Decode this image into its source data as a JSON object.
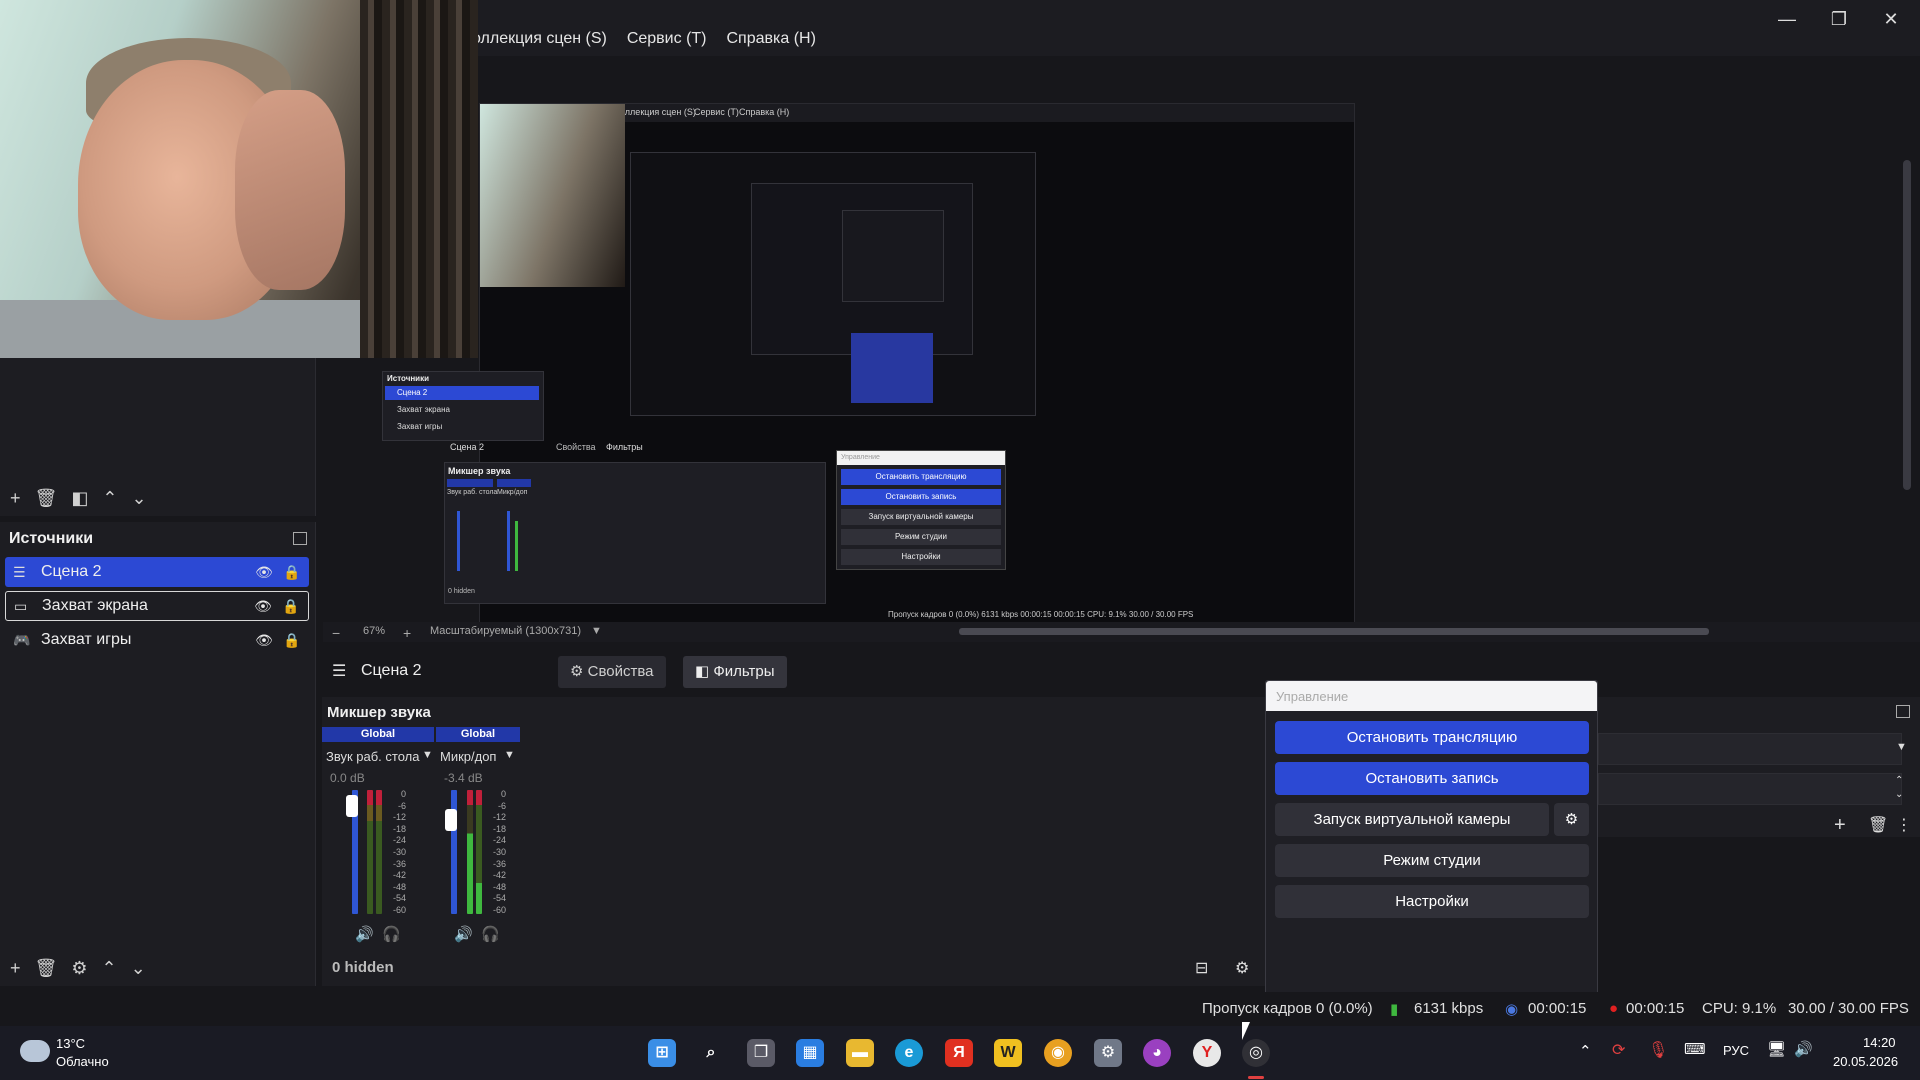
{
  "window": {
    "menu": [
      "оллекция сцен (S)",
      "Сервис (T)",
      "Справка (H)"
    ],
    "minimize_icon": "—",
    "maximize_icon": "❐",
    "close_icon": "✕"
  },
  "preview": {
    "zoom": "67%",
    "scale_mode": "Масштабируемый (1300x731)",
    "nested": {
      "menu": [
        "оллекция сцен (S)",
        "Сервис (T)",
        "Справка (H)"
      ],
      "sources_title": "Источники",
      "sources": [
        "Сцена 2",
        "Захват экрана",
        "Захват игры"
      ],
      "scene_label": "Сцена 2",
      "properties": "Свойства",
      "filters": "Фильтры",
      "mixer_title": "Микшер звука",
      "ch1": "Global",
      "ch2": "Global",
      "ch1_name": "Звук раб. стола",
      "ch2_name": "Микр/доп",
      "ch1_db": "0.0 dB",
      "ch2_db": "-3.4 dB",
      "hidden": "0 hidden",
      "controls_title": "Управление",
      "controls": [
        "Остановить трансляцию",
        "Остановить запись",
        "Запуск виртуальной камеры",
        "Режим студии",
        "Настройки"
      ],
      "status": "Пропуск кадров 0 (0.0%)   6131 kbps   00:00:15   00:00:15   CPU: 9.1%   30.00 / 30.00 FPS"
    }
  },
  "sources": {
    "title": "Источники",
    "items": [
      {
        "label": "Сцена 2",
        "icon": "list-icon"
      },
      {
        "label": "Захват экрана",
        "icon": "monitor-icon"
      },
      {
        "label": "Захват игры",
        "icon": "gamepad-icon"
      }
    ]
  },
  "context_bar": {
    "scene_label": "Сцена 2",
    "properties_label": "Свойства",
    "filters_label": "Фильтры"
  },
  "mixer": {
    "title": "Микшер звука",
    "channels": [
      {
        "header": "Global",
        "name": "Звук раб. стола",
        "db": "0.0 dB"
      },
      {
        "header": "Global",
        "name": "Микр/доп",
        "db": "-3.4 dB"
      }
    ],
    "scale": [
      "0",
      "-6",
      "-12",
      "-18",
      "-24",
      "-30",
      "-36",
      "-42",
      "-48",
      "-54",
      "-60"
    ],
    "hidden_label": "0 hidden"
  },
  "controls": {
    "title": "Управление",
    "stop_stream": "Остановить трансляцию",
    "stop_record": "Остановить запись",
    "virtual_cam": "Запуск виртуальной камеры",
    "studio_mode": "Режим студии",
    "settings": "Настройки"
  },
  "status": {
    "dropped_frames": "Пропуск кадров 0 (0.0%)",
    "bitrate": "6131 kbps",
    "stream_time": "00:00:15",
    "record_time": "00:00:15",
    "cpu": "CPU: 9.1%",
    "fps": "30.00 / 30.00 FPS"
  },
  "taskbar": {
    "weather_temp": "13°C",
    "weather_desc": "Облачно",
    "language": "РУС",
    "time": "14:20",
    "date": "20.05.2026",
    "app_icons": [
      "windows-start-icon",
      "search-icon",
      "task-view-icon",
      "store-icon",
      "file-explorer-icon",
      "edge-icon",
      "yandex-icon",
      "app-w-icon",
      "chrome-icon",
      "settings-icon",
      "color-app-icon",
      "yandex-browser-icon",
      "obs-icon"
    ]
  },
  "colors": {
    "accent": "#2c49d4",
    "record_red": "#e02020",
    "meter_green": "#3fb83f",
    "meter_blue": "#2f56d4"
  }
}
